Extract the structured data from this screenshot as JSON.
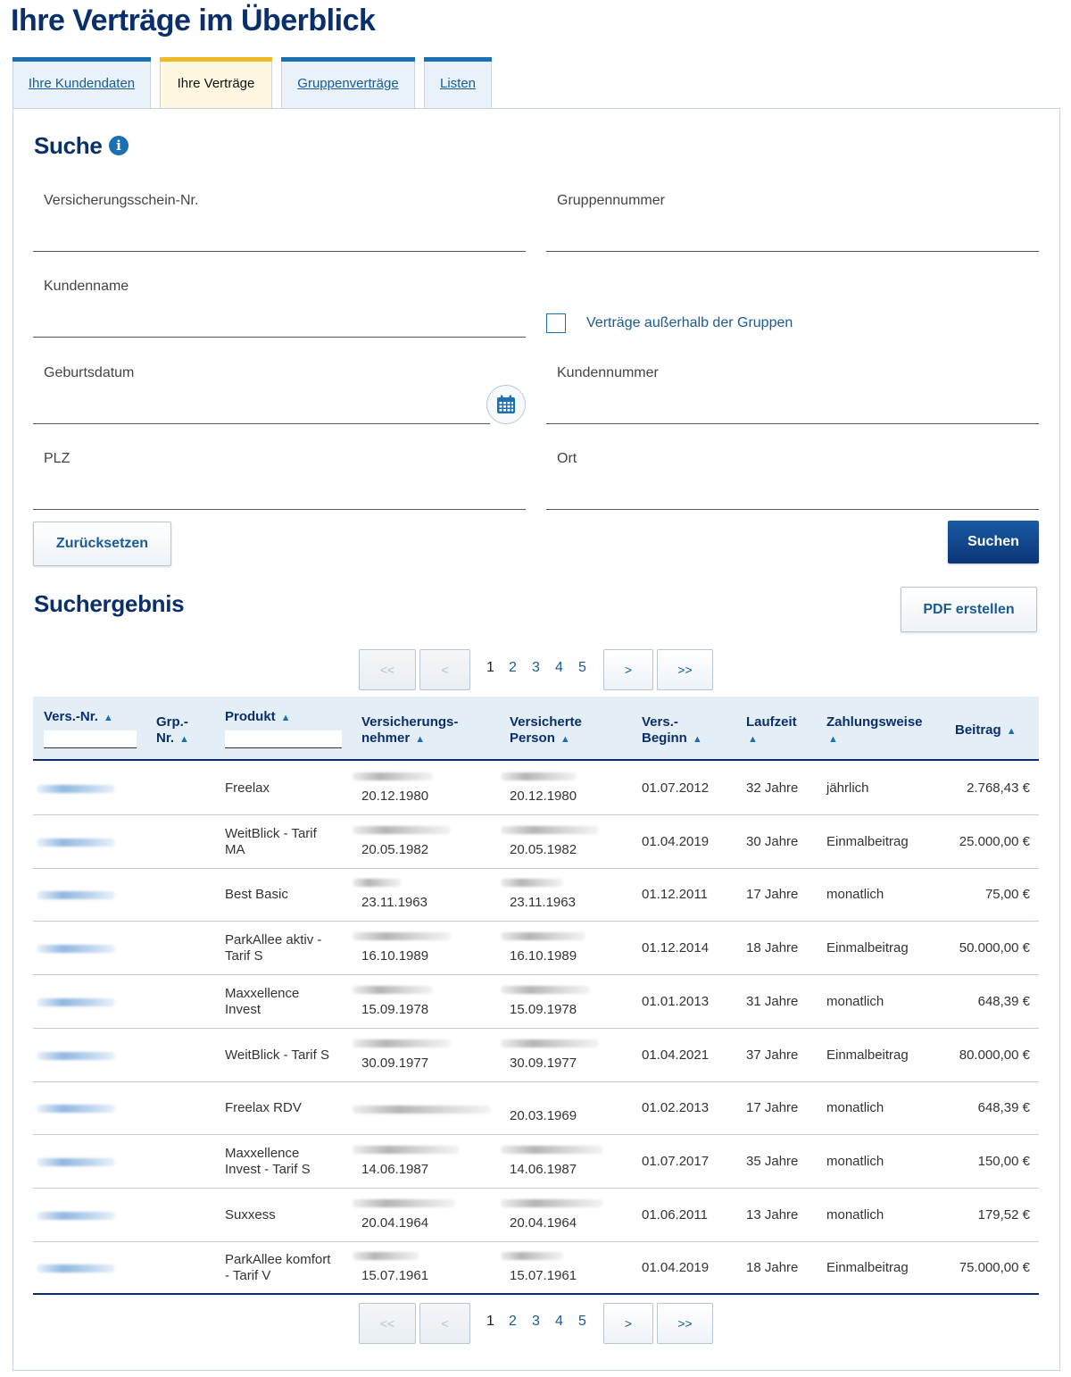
{
  "page_title": "Ihre Verträge im Überblick",
  "tabs": [
    {
      "label": "Ihre Kundendaten",
      "active": false
    },
    {
      "label": "Ihre Verträge",
      "active": true
    },
    {
      "label": "Gruppenverträge",
      "active": false
    },
    {
      "label": "Listen",
      "active": false
    }
  ],
  "search": {
    "title": "Suche",
    "fields": {
      "policy_no": {
        "label": "Versicherungsschein-Nr.",
        "value": ""
      },
      "group_no": {
        "label": "Gruppennummer",
        "value": ""
      },
      "customer_name": {
        "label": "Kundenname",
        "value": ""
      },
      "birth_date": {
        "label": "Geburtsdatum",
        "value": ""
      },
      "customer_no": {
        "label": "Kundennummer",
        "value": ""
      },
      "zip": {
        "label": "PLZ",
        "value": ""
      },
      "city": {
        "label": "Ort",
        "value": ""
      }
    },
    "outside_groups": {
      "label": "Verträge außerhalb der Gruppen",
      "checked": false
    },
    "reset_label": "Zurücksetzen",
    "search_label": "Suchen"
  },
  "results": {
    "title": "Suchergebnis",
    "pdf_label": "PDF erstellen",
    "pagination": {
      "first": "<<",
      "prev": "<",
      "next": ">",
      "last": ">>",
      "pages": [
        "1",
        "2",
        "3",
        "4",
        "5"
      ],
      "current": "1"
    },
    "columns": {
      "vers_nr": "Vers.-Nr.",
      "grp_nr_1": "Grp.-",
      "grp_nr_2": "Nr.",
      "produkt": "Produkt",
      "vn_1": "Versicherungs-",
      "vn_2": "nehmer",
      "vp_1": "Versicherte",
      "vp_2": "Person",
      "beginn_1": "Vers.-",
      "beginn_2": "Beginn",
      "laufzeit": "Laufzeit",
      "zahlweise": "Zahlungsweise",
      "beitrag": "Beitrag"
    },
    "rows": [
      {
        "produkt_1": "Freelax",
        "produkt_2": "",
        "vn_date": "20.12.1980",
        "vp_date": "20.12.1980",
        "beginn": "01.07.2012",
        "laufzeit": "32 Jahre",
        "zahlweise": "jährlich",
        "beitrag": "2.768,43 €"
      },
      {
        "produkt_1": "WeitBlick - Tarif",
        "produkt_2": "MA",
        "vn_date": "20.05.1982",
        "vp_date": "20.05.1982",
        "beginn": "01.04.2019",
        "laufzeit": "30 Jahre",
        "zahlweise": "Einmalbeitrag",
        "beitrag": "25.000,00 €"
      },
      {
        "produkt_1": "Best Basic",
        "produkt_2": "",
        "vn_date": "23.11.1963",
        "vp_date": "23.11.1963",
        "beginn": "01.12.2011",
        "laufzeit": "17 Jahre",
        "zahlweise": "monatlich",
        "beitrag": "75,00 €"
      },
      {
        "produkt_1": "ParkAllee aktiv -",
        "produkt_2": "Tarif S",
        "vn_date": "16.10.1989",
        "vp_date": "16.10.1989",
        "beginn": "01.12.2014",
        "laufzeit": "18 Jahre",
        "zahlweise": "Einmalbeitrag",
        "beitrag": "50.000,00 €"
      },
      {
        "produkt_1": "Maxxellence",
        "produkt_2": "Invest",
        "vn_date": "15.09.1978",
        "vp_date": "15.09.1978",
        "beginn": "01.01.2013",
        "laufzeit": "31 Jahre",
        "zahlweise": "monatlich",
        "beitrag": "648,39 €"
      },
      {
        "produkt_1": "WeitBlick - Tarif S",
        "produkt_2": "",
        "vn_date": "30.09.1977",
        "vp_date": "30.09.1977",
        "beginn": "01.04.2021",
        "laufzeit": "37 Jahre",
        "zahlweise": "Einmalbeitrag",
        "beitrag": "80.000,00 €"
      },
      {
        "produkt_1": "Freelax RDV",
        "produkt_2": "",
        "vn_date": "",
        "vp_date": "20.03.1969",
        "beginn": "01.02.2013",
        "laufzeit": "17 Jahre",
        "zahlweise": "monatlich",
        "beitrag": "648,39 €"
      },
      {
        "produkt_1": "Maxxellence",
        "produkt_2": "Invest - Tarif S",
        "vn_date": "14.06.1987",
        "vp_date": "14.06.1987",
        "beginn": "01.07.2017",
        "laufzeit": "35 Jahre",
        "zahlweise": "monatlich",
        "beitrag": "150,00 €"
      },
      {
        "produkt_1": "Suxxess",
        "produkt_2": "",
        "vn_date": "20.04.1964",
        "vp_date": "20.04.1964",
        "beginn": "01.06.2011",
        "laufzeit": "13 Jahre",
        "zahlweise": "monatlich",
        "beitrag": "179,52 €"
      },
      {
        "produkt_1": "ParkAllee komfort",
        "produkt_2": "- Tarif V",
        "vn_date": "15.07.1961",
        "vp_date": "15.07.1961",
        "beginn": "01.04.2019",
        "laufzeit": "18 Jahre",
        "zahlweise": "Einmalbeitrag",
        "beitrag": "75.000,00 €"
      }
    ]
  },
  "colors": {
    "brand_navy": "#0a2f6b",
    "link_blue": "#1a5a96",
    "tab_active_bar": "#f0b928",
    "tab_bar": "#1b6fb3"
  },
  "icons": {
    "info": "info-icon",
    "calendar": "calendar-icon",
    "sort": "sort-icon"
  }
}
